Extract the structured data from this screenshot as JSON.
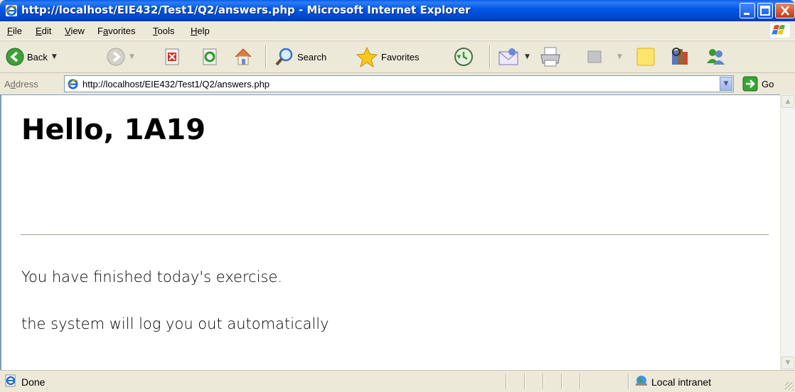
{
  "window": {
    "title": "http://localhost/EIE432/Test1/Q2/answers.php - Microsoft Internet Explorer"
  },
  "menu": {
    "items": [
      {
        "label": "File",
        "u": "F",
        "rest": "ile"
      },
      {
        "label": "Edit",
        "u": "E",
        "rest": "dit"
      },
      {
        "label": "View",
        "u": "V",
        "rest": "iew"
      },
      {
        "label": "Favorites",
        "pre": "F",
        "u": "a",
        "rest": "vorites"
      },
      {
        "label": "Tools",
        "u": "T",
        "rest": "ools"
      },
      {
        "label": "Help",
        "u": "H",
        "rest": "elp"
      }
    ]
  },
  "toolbar": {
    "back_label": "Back",
    "search_label": "Search",
    "favorites_label": "Favorites"
  },
  "address": {
    "label": "Address",
    "label_u": "d",
    "url": "http://localhost/EIE432/Test1/Q2/answers.php",
    "go_label": "Go"
  },
  "page": {
    "heading": "Hello, 1A19",
    "paragraphs": [
      "You have finished today's exercise.",
      "the system will log you out automatically"
    ]
  },
  "status": {
    "text": "Done",
    "zone": "Local intranet"
  },
  "colors": {
    "titlebar": "#0058e6",
    "chrome": "#ece9d8",
    "content_bg": "#ffffff"
  }
}
